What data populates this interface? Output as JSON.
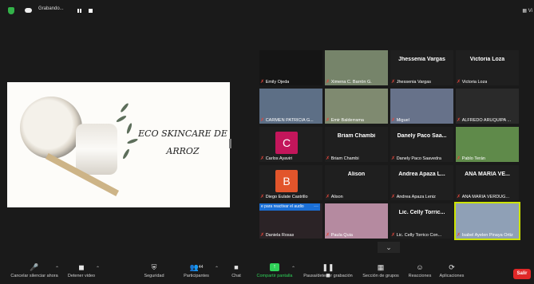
{
  "top_bar": {
    "recording_label": "Grabando...",
    "view_label": "Vi"
  },
  "shared_screen": {
    "title_line1": "ECO SKINCARE DE",
    "title_line2": "ARROZ"
  },
  "participants": [
    {
      "name": "Emily Ojeda",
      "big_name": "",
      "kind": "video",
      "color": "#151515"
    },
    {
      "name": "Ximena C. Barrón G.",
      "big_name": "",
      "kind": "video",
      "color": "#76846a"
    },
    {
      "name": "Jhessenia Vargas",
      "big_name": "Jhessenia Vargas",
      "kind": "name",
      "color": "#1f1f1f"
    },
    {
      "name": "Victoria Loza",
      "big_name": "Victoria Loza",
      "kind": "name",
      "color": "#1f1f1f"
    },
    {
      "name": "CARMEN PATRICIA G...",
      "big_name": "",
      "kind": "video",
      "color": "#5d6f86"
    },
    {
      "name": "Emir Balderrama",
      "big_name": "",
      "kind": "video",
      "color": "#7f8a70"
    },
    {
      "name": "Miguel",
      "big_name": "",
      "kind": "video",
      "color": "#67728a"
    },
    {
      "name": "ALFREDO ARUQUIPA ...",
      "big_name": "",
      "kind": "video",
      "color": "#2a2a2a"
    },
    {
      "name": "Carlos Ayaviri",
      "big_name": "",
      "kind": "avatar",
      "avatar_letter": "C",
      "color": "#c3165b"
    },
    {
      "name": "Briam Chambi",
      "big_name": "Briam Chambi",
      "kind": "name",
      "color": "#1f1f1f"
    },
    {
      "name": "Danely Paco Saavedra",
      "big_name": "Danely Paco Saa...",
      "kind": "name",
      "color": "#1f1f1f"
    },
    {
      "name": "Pablo Terán",
      "big_name": "",
      "kind": "video",
      "color": "#5f8a4a"
    },
    {
      "name": "Diego Eulate Castrillo",
      "big_name": "",
      "kind": "avatar",
      "avatar_letter": "B",
      "color": "#e2552b"
    },
    {
      "name": "Alison",
      "big_name": "Alison",
      "kind": "name",
      "color": "#1f1f1f"
    },
    {
      "name": "Andrea Apaza Leniz",
      "big_name": "Andrea Apaza L...",
      "kind": "name",
      "color": "#1f1f1f"
    },
    {
      "name": "ANA MARIA VERDUG...",
      "big_name": "ANA MARIA VE...",
      "kind": "name",
      "color": "#1f1f1f"
    },
    {
      "name": "Daniela Rosas",
      "big_name": "",
      "kind": "video",
      "color": "#2b2326"
    },
    {
      "name": "Paula Quia",
      "big_name": "",
      "kind": "video",
      "color": "#b58aa0"
    },
    {
      "name": "Lic. Celly Torrico Con...",
      "big_name": "Lic. Celly Torric...",
      "kind": "name",
      "color": "#1f1f1f"
    },
    {
      "name": "Isabel Ayelen Pinaya Ortiz",
      "big_name": "",
      "kind": "video",
      "color": "#8fa0b6",
      "active": true
    }
  ],
  "audio_banner": {
    "text": "e para reactivar el audio",
    "dots": "···"
  },
  "toolbar": {
    "mute": "Cancelar silenciar ahora",
    "video": "Detener video",
    "security": "Seguridad",
    "participants": "Participantes",
    "participants_count": "44",
    "chat": "Chat",
    "share": "Compartir pantalla",
    "pause_recording": "Pausa/detener grabación",
    "breakout": "Sección de grupos",
    "reactions": "Reacciones",
    "apps": "Aplicaciones",
    "leave": "Salir"
  },
  "colors": {
    "accent_green": "#2fd158",
    "leave_red": "#e02828",
    "active_speaker": "#cde300",
    "banner_blue": "#1a6fd6"
  }
}
